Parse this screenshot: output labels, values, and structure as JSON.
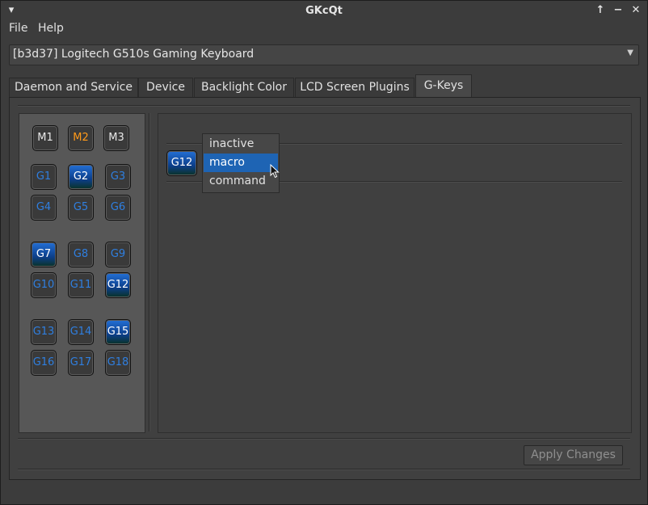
{
  "window": {
    "title": "GKcQt",
    "menu_icon": "chevron-down-icon",
    "controls": [
      "maximize-up-arrow-icon",
      "minimize-icon",
      "close-icon"
    ]
  },
  "menubar": {
    "file_label": "File",
    "help_label": "Help"
  },
  "device_select": {
    "value": "[b3d37] Logitech G510s Gaming Keyboard"
  },
  "tabs": [
    {
      "label": "Daemon and Service"
    },
    {
      "label": "Device"
    },
    {
      "label": "Backlight Color"
    },
    {
      "label": "LCD Screen Plugins"
    },
    {
      "label": "G-Keys"
    }
  ],
  "active_tab": "G-Keys",
  "mode_keys": [
    {
      "label": "M1",
      "active": false
    },
    {
      "label": "M2",
      "active": true
    },
    {
      "label": "M3",
      "active": false
    }
  ],
  "g_keys": [
    {
      "label": "G1",
      "selected": false
    },
    {
      "label": "G2",
      "selected": true
    },
    {
      "label": "G3",
      "selected": false
    },
    {
      "label": "G4",
      "selected": false
    },
    {
      "label": "G5",
      "selected": false
    },
    {
      "label": "G6",
      "selected": false
    },
    {
      "label": "G7",
      "selected": true
    },
    {
      "label": "G8",
      "selected": false
    },
    {
      "label": "G9",
      "selected": false
    },
    {
      "label": "G10",
      "selected": false
    },
    {
      "label": "G11",
      "selected": false
    },
    {
      "label": "G12",
      "selected": true
    },
    {
      "label": "G13",
      "selected": false
    },
    {
      "label": "G14",
      "selected": false
    },
    {
      "label": "G15",
      "selected": true
    },
    {
      "label": "G16",
      "selected": false
    },
    {
      "label": "G17",
      "selected": false
    },
    {
      "label": "G18",
      "selected": false
    }
  ],
  "editor": {
    "key_label": "G12",
    "mode_options": [
      "inactive",
      "macro",
      "command"
    ],
    "highlighted_option": "macro"
  },
  "apply_button": {
    "label": "Apply Changes",
    "enabled": false
  },
  "colors": {
    "accent": "#1e64b4",
    "key_text": "#2f7fe0",
    "active_mode": "#ff9a1a"
  }
}
